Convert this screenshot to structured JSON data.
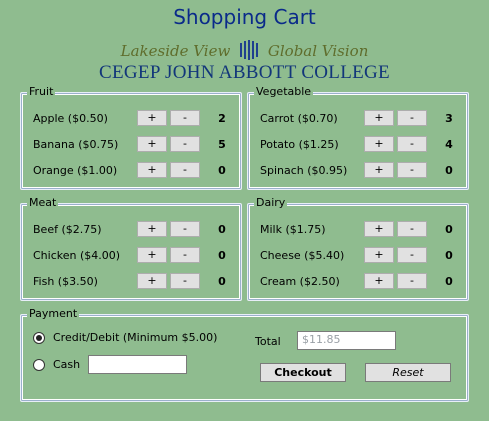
{
  "title": "Shopping Cart",
  "logo": {
    "tagline_left": "Lakeside View",
    "tagline_right": "Global Vision",
    "college": "CEGEP JOHN ABBOTT COLLEGE"
  },
  "buttons": {
    "plus": "+",
    "minus": "-"
  },
  "groups": {
    "fruit": {
      "title": "Fruit",
      "items": [
        {
          "label": "Apple ($0.50)",
          "qty": "2"
        },
        {
          "label": "Banana ($0.75)",
          "qty": "5"
        },
        {
          "label": "Orange ($1.00)",
          "qty": "0"
        }
      ]
    },
    "vegetable": {
      "title": "Vegetable",
      "items": [
        {
          "label": "Carrot ($0.70)",
          "qty": "3"
        },
        {
          "label": "Potato ($1.25)",
          "qty": "4"
        },
        {
          "label": "Spinach ($0.95)",
          "qty": "0"
        }
      ]
    },
    "meat": {
      "title": "Meat",
      "items": [
        {
          "label": "Beef ($2.75)",
          "qty": "0"
        },
        {
          "label": "Chicken ($4.00)",
          "qty": "0"
        },
        {
          "label": "Fish ($3.50)",
          "qty": "0"
        }
      ]
    },
    "dairy": {
      "title": "Dairy",
      "items": [
        {
          "label": "Milk ($1.75)",
          "qty": "0"
        },
        {
          "label": "Cheese ($5.40)",
          "qty": "0"
        },
        {
          "label": "Cream ($2.50)",
          "qty": "0"
        }
      ]
    }
  },
  "payment": {
    "title": "Payment",
    "credit_label": "Credit/Debit (Minimum $5.00)",
    "credit_selected": true,
    "cash_label": "Cash",
    "cash_value": "",
    "total_label": "Total",
    "total_value": "$11.85",
    "checkout_label": "Checkout",
    "reset_label": "Reset"
  },
  "colors": {
    "background": "#8fbc8f",
    "title": "#0a2a8a",
    "college": "#12367a",
    "tagline": "#5f6d2c"
  }
}
